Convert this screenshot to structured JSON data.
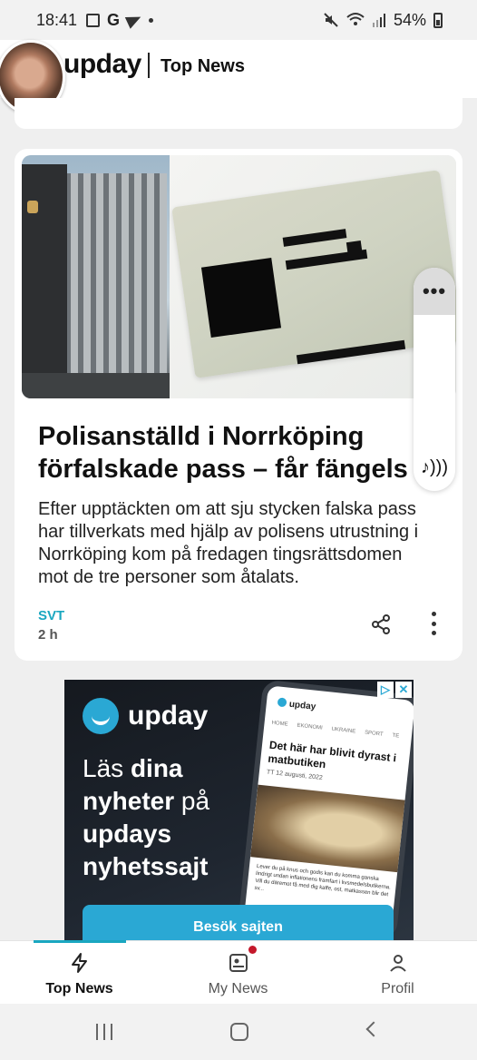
{
  "status_bar": {
    "time": "18:41",
    "battery": "54%",
    "icons": [
      "notification-square-icon",
      "google-icon",
      "telegram-icon",
      "dot-icon",
      "mute-icon",
      "wifi-icon",
      "signal-icon",
      "battery-icon"
    ]
  },
  "header": {
    "brand": "upday",
    "section": "Top News"
  },
  "article": {
    "title_line1": "Polisanställd i Norrköping",
    "title_line2": "förfalskade pass – får fängels",
    "summary_lines": [
      "Efter upptäckten om att sju stycken falska pass",
      "har tillverkats med hjälp av polisens utrustning i",
      "Norrköping kom på fredagen tingsrättsdomen",
      "mot de tre personer som åtalats."
    ],
    "source": "SVT",
    "time": "2 h",
    "media_controls": {
      "more": "•••"
    }
  },
  "ad": {
    "brand": "upday",
    "headline_part1": "Läs ",
    "headline_bold1": "dina",
    "headline_part2": "nyheter",
    "headline_part3": " på",
    "headline_part4": "updays",
    "headline_part5": "nyhetssajt",
    "cta": "Besök sajten",
    "phone": {
      "brand": "upday",
      "tabs": [
        "HOME",
        "EKONOMI",
        "UKRAINE",
        "SPORT",
        "TE"
      ],
      "title": "Det här har blivit dyrast i matbutiken",
      "meta": "TT   12 augusti, 2022",
      "body": "Lever du på knus och godis kan du komma ganska lindrigt undan inflationens framfart i livsmedelsbutikerna. Vill du däremot få med dig kaffe, ost, matkassen blir det sv..."
    },
    "choice_icons": [
      "▷",
      "✕"
    ]
  },
  "bottom_nav": {
    "items": [
      {
        "label": "Top News",
        "icon": "lightning-icon",
        "active": true
      },
      {
        "label": "My News",
        "icon": "my-news-icon",
        "active": false,
        "badge": true
      },
      {
        "label": "Profil",
        "icon": "person-icon",
        "active": false
      }
    ]
  },
  "colors": {
    "accent": "#1aa7c0",
    "badge": "#c4182b",
    "ad_blue": "#2aa8d4"
  }
}
